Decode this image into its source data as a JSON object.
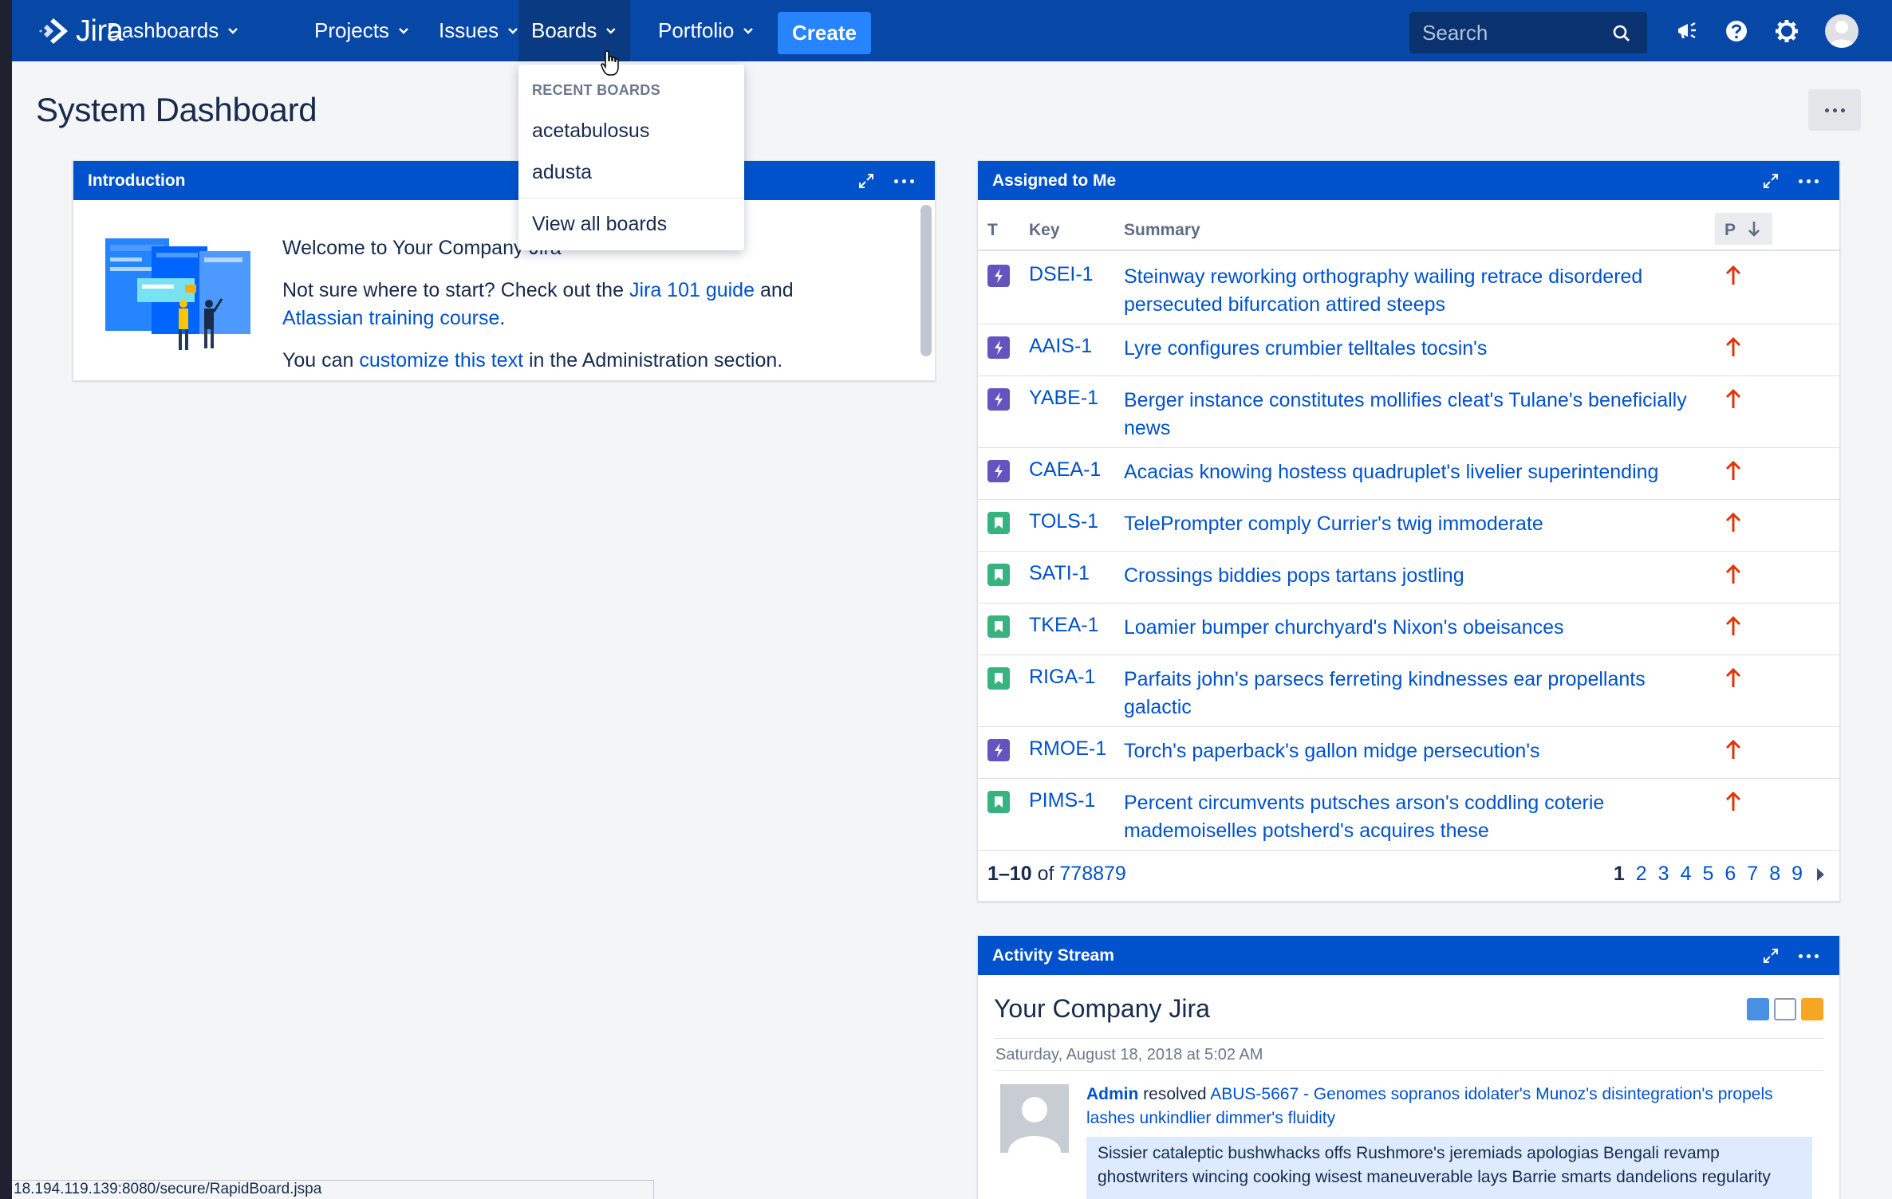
{
  "app": {
    "logo_text": "Jira"
  },
  "nav": {
    "dashboards": "Dashboards",
    "projects": "Projects",
    "issues": "Issues",
    "boards": "Boards",
    "portfolio": "Portfolio",
    "create": "Create",
    "search_placeholder": "Search"
  },
  "boards_dropdown": {
    "header": "RECENT BOARDS",
    "items": [
      "acetabulosus",
      "adusta"
    ],
    "view_all": "View all boards"
  },
  "page": {
    "title": "System Dashboard"
  },
  "intro": {
    "title": "Introduction",
    "welcome": "Welcome to Your Company Jira",
    "line2_a": "Not sure where to start? Check out the ",
    "line2_link1": "Jira 101 guide",
    "line2_b": " and",
    "line2_link2": "Atlassian training course",
    "line2_c": ".",
    "line3_a": "You can ",
    "line3_link": "customize this text",
    "line3_b": " in the Administration section."
  },
  "assigned": {
    "title": "Assigned to Me",
    "columns": {
      "type": "T",
      "key": "Key",
      "summary": "Summary",
      "priority": "P"
    },
    "rows": [
      {
        "type": "epic",
        "key": "DSEI-1",
        "summary": "Steinway reworking orthography wailing retrace disordered persecuted bifurcation attired steeps"
      },
      {
        "type": "epic",
        "key": "AAIS-1",
        "summary": "Lyre configures crumbier telltales tocsin's"
      },
      {
        "type": "epic",
        "key": "YABE-1",
        "summary": "Berger instance constitutes mollifies cleat's Tulane's beneficially news"
      },
      {
        "type": "epic",
        "key": "CAEA-1",
        "summary": "Acacias knowing hostess quadruplet's livelier superintending"
      },
      {
        "type": "story",
        "key": "TOLS-1",
        "summary": "TelePrompter comply Currier's twig immoderate"
      },
      {
        "type": "story",
        "key": "SATI-1",
        "summary": "Crossings biddies pops tartans jostling"
      },
      {
        "type": "story",
        "key": "TKEA-1",
        "summary": "Loamier bumper churchyard's Nixon's obeisances"
      },
      {
        "type": "story",
        "key": "RIGA-1",
        "summary": "Parfaits john's parsecs ferreting kindnesses ear propellants galactic"
      },
      {
        "type": "epic",
        "key": "RMOE-1",
        "summary": "Torch's paperback's gallon midge persecution's"
      },
      {
        "type": "story",
        "key": "PIMS-1",
        "summary": "Percent circumvents putsches arson's coddling coterie mademoiselles potsherd's acquires these"
      }
    ],
    "pager": {
      "range": "1–10",
      "of": "of",
      "total": "778879",
      "pages": [
        "1",
        "2",
        "3",
        "4",
        "5",
        "6",
        "7",
        "8",
        "9"
      ]
    }
  },
  "activity": {
    "title": "Activity Stream",
    "heading": "Your Company Jira",
    "date": "Saturday, August 18, 2018 at 5:02 AM",
    "actor": "Admin",
    "verb": "resolved",
    "issue": "ABUS-5667 - Genomes sopranos idolater's Munoz's disintegration's propels lashes unkindlier dimmer's fluidity",
    "quote": "Sissier cataleptic bushwhacks offs Rushmore's jeremiads apologias Bengali revamp ghostwriters wincing cooking wisest maneuverable lays Barrie smarts dandelions regularity"
  },
  "status_url": "18.194.119.139:8080/secure/RapidBoard.jspa",
  "colors": {
    "nav": "#0747a6",
    "gadget_header": "#0052cc",
    "link": "#0052cc",
    "story": "#36b37e",
    "epic": "#6554c0",
    "priority_high": "#de350b"
  }
}
